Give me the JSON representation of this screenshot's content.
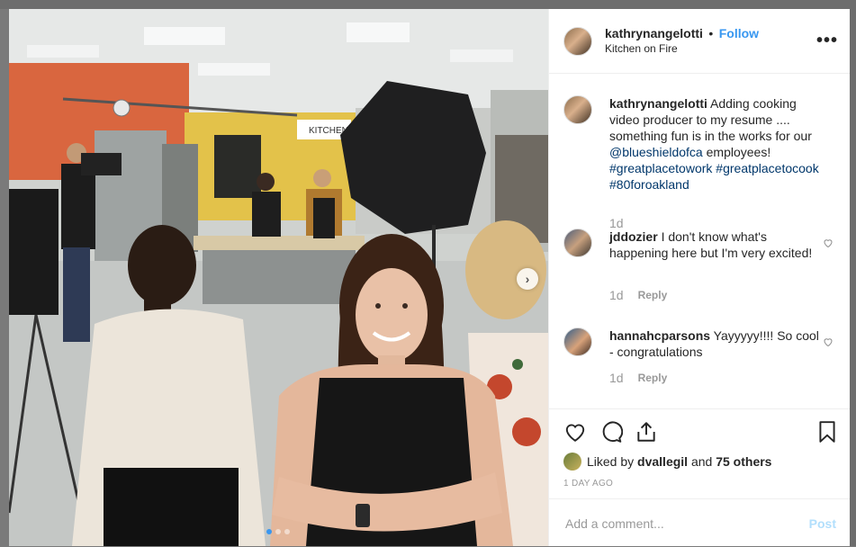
{
  "post": {
    "username": "kathrynangelotti",
    "separator": "•",
    "follow_label": "Follow",
    "location": "Kitchen on Fire",
    "more_icon": "more-options-icon"
  },
  "caption": {
    "username": "kathrynangelotti",
    "text_1": "Adding cooking video producer to my resume .... something fun is in the works for our",
    "mention": "@blueshieldofca",
    "text_2": "employees!",
    "hashtags": [
      "#greatplacetowork",
      "#greatplacetocook",
      "#80foroakland"
    ],
    "age": "1d"
  },
  "comments": [
    {
      "username": "jddozier",
      "text": "I don't know what's happening here but I'm very excited!",
      "age": "1d",
      "reply_label": "Reply"
    },
    {
      "username": "hannahcparsons",
      "text": "Yayyyyy!!!! So cool - congratulations",
      "age": "1d",
      "reply_label": "Reply"
    }
  ],
  "likes": {
    "prefix": "Liked by",
    "user": "dvallegil",
    "joiner": "and",
    "others": "75 others"
  },
  "timestamp": "1 day ago",
  "add_comment": {
    "placeholder": "Add a comment...",
    "post_label": "Post"
  },
  "media": {
    "carousel_total": 3,
    "carousel_index": 1,
    "photo_sign_text": "KITCHEN"
  },
  "colors": {
    "link_blue": "#3897f0",
    "mention_navy": "#00376b",
    "post_disabled": "#b2dffc",
    "muted_gray": "#999999"
  }
}
